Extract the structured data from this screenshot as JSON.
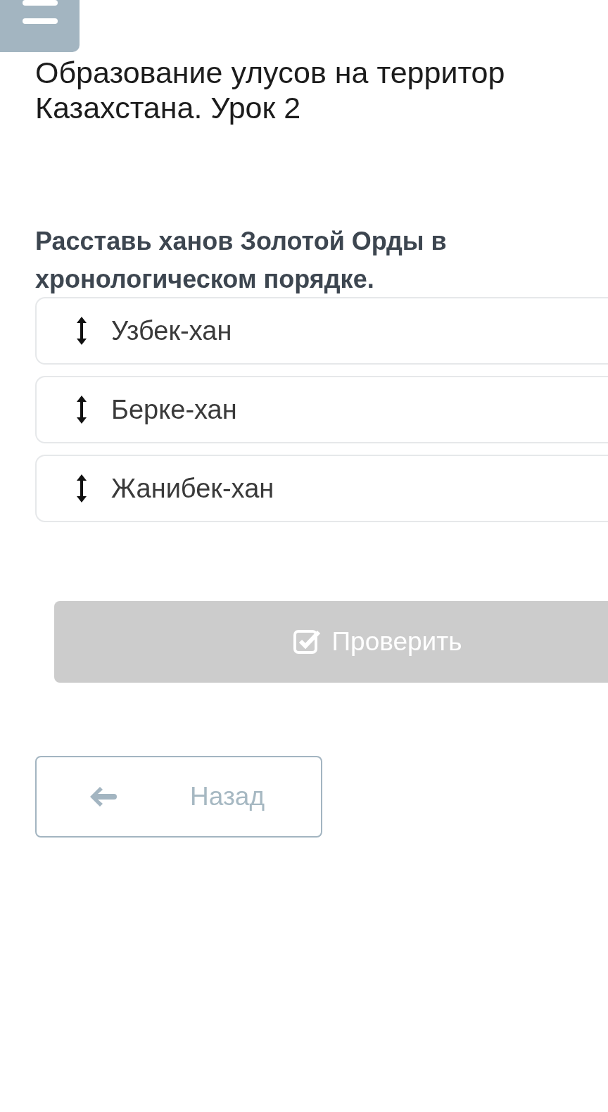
{
  "title_lines": [
    "Образование улусов на территор",
    "Казахстана. Урок 2"
  ],
  "question": "Расставь ханов Золотой Орды в хронологическом порядке.",
  "items": [
    {
      "label": "Узбек-хан"
    },
    {
      "label": "Берке-хан"
    },
    {
      "label": "Жанибек-хан"
    }
  ],
  "check_button": {
    "label": "Проверить",
    "disabled": true
  },
  "back_button": {
    "label": "Назад"
  }
}
